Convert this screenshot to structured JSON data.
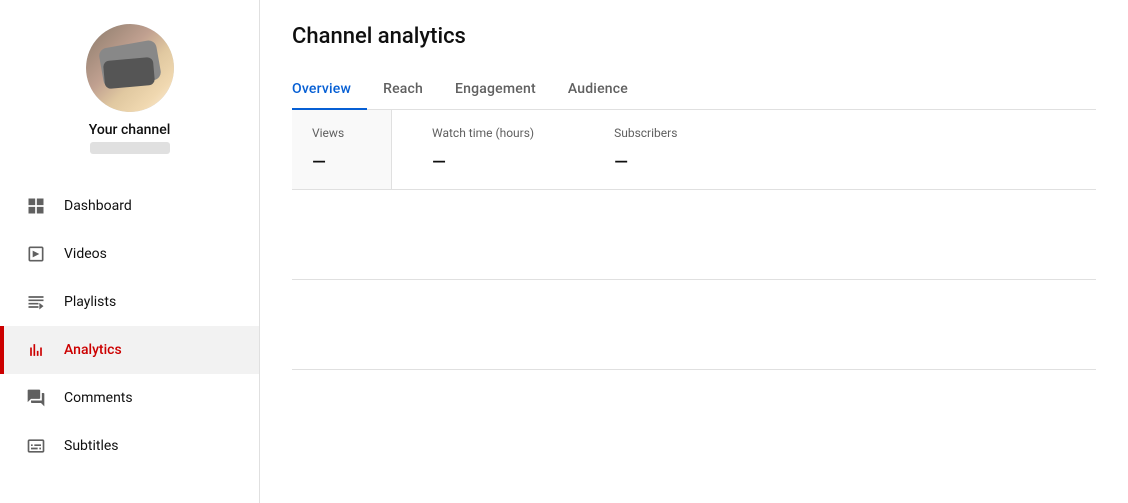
{
  "sidebar": {
    "channel_label": "Your channel",
    "nav_items": [
      {
        "id": "dashboard",
        "label": "Dashboard",
        "icon": "dashboard-icon",
        "active": false
      },
      {
        "id": "videos",
        "label": "Videos",
        "icon": "videos-icon",
        "active": false
      },
      {
        "id": "playlists",
        "label": "Playlists",
        "icon": "playlists-icon",
        "active": false
      },
      {
        "id": "analytics",
        "label": "Analytics",
        "icon": "analytics-icon",
        "active": true
      },
      {
        "id": "comments",
        "label": "Comments",
        "icon": "comments-icon",
        "active": false
      },
      {
        "id": "subtitles",
        "label": "Subtitles",
        "icon": "subtitles-icon",
        "active": false
      }
    ]
  },
  "main": {
    "page_title": "Channel analytics",
    "tabs": [
      {
        "id": "overview",
        "label": "Overview",
        "active": true
      },
      {
        "id": "reach",
        "label": "Reach",
        "active": false
      },
      {
        "id": "engagement",
        "label": "Engagement",
        "active": false
      },
      {
        "id": "audience",
        "label": "Audience",
        "active": false
      }
    ],
    "stats": [
      {
        "id": "views",
        "label": "Views",
        "value": "—",
        "selected": true
      },
      {
        "id": "watch-time",
        "label": "Watch time (hours)",
        "value": "—",
        "selected": false
      },
      {
        "id": "subscribers",
        "label": "Subscribers",
        "value": "—",
        "selected": false
      }
    ]
  }
}
